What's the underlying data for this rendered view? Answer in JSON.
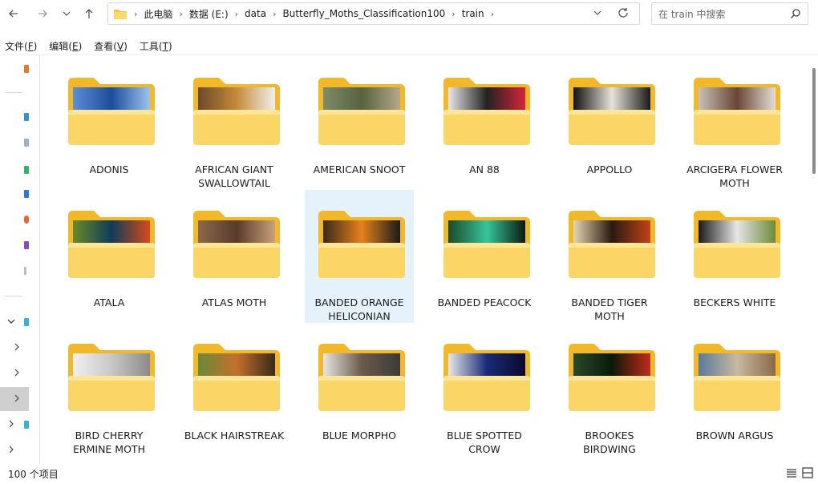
{
  "nav": {
    "back_icon": "back-arrow-icon",
    "forward_icon": "forward-arrow-icon",
    "recent_icon": "chevron-down-icon",
    "up_icon": "up-arrow-icon"
  },
  "breadcrumb": [
    "此电脑",
    "数据 (E:)",
    "data",
    "Butterfly_Moths_Classification100",
    "train"
  ],
  "search": {
    "placeholder": "在 train 中搜索"
  },
  "menu": [
    {
      "text": "文件",
      "key": "F"
    },
    {
      "text": "编辑",
      "key": "E"
    },
    {
      "text": "查看",
      "key": "V"
    },
    {
      "text": "工具",
      "key": "T"
    }
  ],
  "folders": [
    {
      "name": "ADONIS",
      "thumb": [
        "#5b8fd6",
        "#1d4c9a",
        "#9bc3ee"
      ]
    },
    {
      "name": "AFRICAN GIANT SWALLOWTAIL",
      "thumb": [
        "#6b4a2a",
        "#c58a3a",
        "#f2f0ea"
      ]
    },
    {
      "name": "AMERICAN SNOOT",
      "thumb": [
        "#7d8c6b",
        "#58623f",
        "#b4a88a"
      ]
    },
    {
      "name": "AN 88",
      "thumb": [
        "#e8e8e8",
        "#222222",
        "#d8233a"
      ]
    },
    {
      "name": "APPOLLO",
      "thumb": [
        "#111111",
        "#e6e3d8",
        "#1a1a1a"
      ]
    },
    {
      "name": "ARCIGERA FLOWER MOTH",
      "thumb": [
        "#c9c2b8",
        "#6a4533",
        "#e4dfd8"
      ]
    },
    {
      "name": "ATALA",
      "thumb": [
        "#6a8a2a",
        "#0f3b5a",
        "#d84a1c"
      ]
    },
    {
      "name": "ATLAS MOTH",
      "thumb": [
        "#8a6a4a",
        "#5a3a2a",
        "#c9a07a"
      ]
    },
    {
      "name": "BANDED ORANGE HELICONIAN",
      "thumb": [
        "#3a2a1a",
        "#e6801c",
        "#1a1a1a"
      ]
    },
    {
      "name": "BANDED PEACOCK",
      "thumb": [
        "#1a4a2a",
        "#37c49a",
        "#0a1a10"
      ]
    },
    {
      "name": "BANDED TIGER MOTH",
      "thumb": [
        "#e6d6b0",
        "#2a1a10",
        "#c4421a"
      ]
    },
    {
      "name": "BECKERS WHITE",
      "thumb": [
        "#1a1a1a",
        "#e6e6e6",
        "#6a8a3a"
      ]
    },
    {
      "name": "BIRD CHERRY ERMINE MOTH",
      "thumb": [
        "#f0f0f0",
        "#c8c8c8",
        "#8a8a8a"
      ]
    },
    {
      "name": "BLACK HAIRSTREAK",
      "thumb": [
        "#6a8a3a",
        "#c4702a",
        "#3a2a1a"
      ]
    },
    {
      "name": "BLUE MORPHO",
      "thumb": [
        "#e8e6e2",
        "#6a5a4a",
        "#3a3a3a"
      ]
    },
    {
      "name": "BLUE SPOTTED CROW",
      "thumb": [
        "#e8e8e8",
        "#1a2a7a",
        "#0a0a2a"
      ]
    },
    {
      "name": "BROOKES BIRDWING",
      "thumb": [
        "#2a4a2a",
        "#0a1a0a",
        "#c42a1a"
      ]
    },
    {
      "name": "BROWN ARGUS",
      "thumb": [
        "#5a7a9a",
        "#c8b8a0",
        "#8a6a4a"
      ]
    }
  ],
  "status": {
    "count": "100 个项目"
  }
}
